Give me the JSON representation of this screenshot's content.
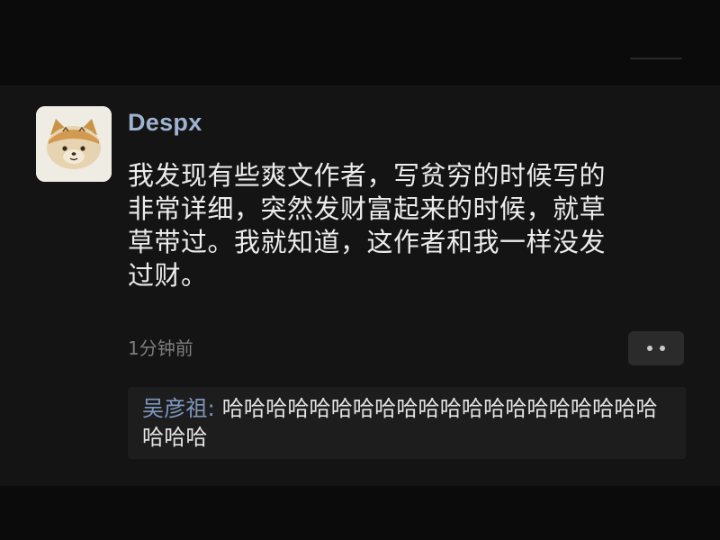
{
  "post": {
    "author": "Despx",
    "text": "我发现有些爽文作者，写贫穷的时候写的\n非常详细，突然发财富起来的时候，就草\n草带过。我就知道，这作者和我一样没发\n过财。",
    "timestamp": "1分钟前",
    "avatar_icon": "bear-avatar-icon",
    "more_icon": "more-dots-icon"
  },
  "comment": {
    "author": "吴彦祖",
    "separator": ": ",
    "text": "哈哈哈哈哈哈哈哈哈哈哈哈哈哈哈哈哈哈哈哈哈哈哈"
  },
  "colors": {
    "background": "#0b0b0b",
    "card": "#141414",
    "name_blue": "#9fb2cf",
    "comment_author_blue": "#7f97bd",
    "text": "#ececec",
    "muted": "#7d7d7d"
  }
}
